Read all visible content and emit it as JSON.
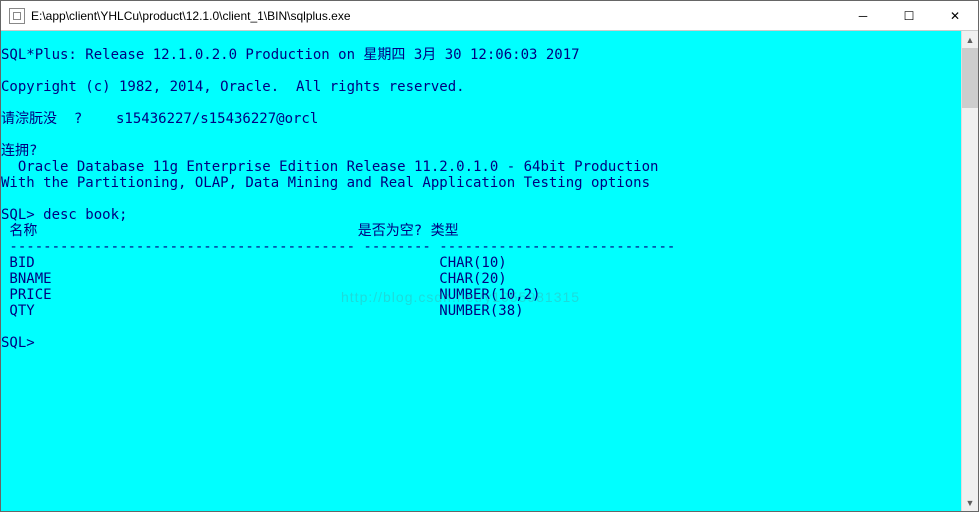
{
  "window": {
    "title": "E:\\app\\client\\YHLCu\\product\\12.1.0\\client_1\\BIN\\sqlplus.exe"
  },
  "console": {
    "text": "\nSQL*Plus: Release 12.1.0.2.0 Production on 星期四 3月 30 12:06:03 2017\n\nCopyright (c) 1982, 2014, Oracle.  All rights reserved.\n\n请淙朊没  ?    s15436227/s15436227@orcl\n\n连拥?\n  Oracle Database 11g Enterprise Edition Release 11.2.0.1.0 - 64bit Production\nWith the Partitioning, OLAP, Data Mining and Real Application Testing options\n\nSQL> desc book;\n 名称                                      是否为空? 类型\n ----------------------------------------- -------- ----------------------------\n BID                                                CHAR(10)\n BNAME                                              CHAR(20)\n PRICE                                              NUMBER(10,2)\n QTY                                                NUMBER(38)\n\nSQL>"
  },
  "watermark": {
    "text": "http://blog.csdn.net/y1055981315"
  },
  "controls": {
    "minimize": "─",
    "maximize": "☐",
    "close": "✕",
    "scroll_up": "▲",
    "scroll_down": "▼"
  }
}
